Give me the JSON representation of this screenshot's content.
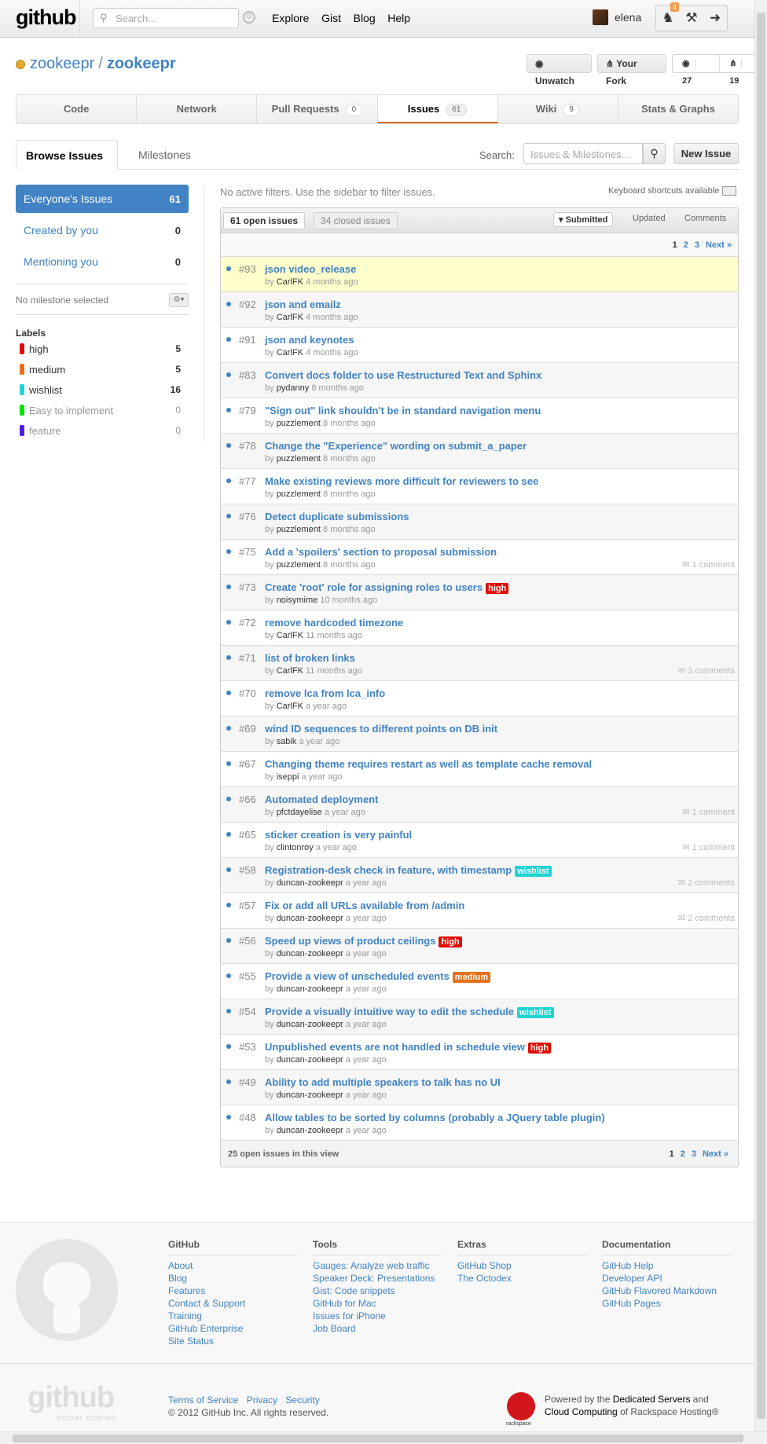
{
  "header": {
    "logo": "github",
    "search_placeholder": "Search...",
    "nav": [
      "Explore",
      "Gist",
      "Blog",
      "Help"
    ],
    "username": "elena",
    "notification_count": "4"
  },
  "repo": {
    "owner": "zookeepr",
    "name": "zookeepr",
    "unwatch_label": "Unwatch",
    "fork_label": "Your Fork",
    "watchers": "27",
    "forks": "19"
  },
  "tabs": [
    {
      "label": "Code",
      "count": ""
    },
    {
      "label": "Network",
      "count": ""
    },
    {
      "label": "Pull Requests",
      "count": "0"
    },
    {
      "label": "Issues",
      "count": "61"
    },
    {
      "label": "Wiki",
      "count": "9"
    },
    {
      "label": "Stats & Graphs",
      "count": ""
    }
  ],
  "subnav": {
    "browse": "Browse Issues",
    "milestones": "Milestones",
    "search_label": "Search:",
    "search_placeholder": "Issues & Milestones...",
    "new_issue": "New Issue"
  },
  "sidebar": {
    "filters": [
      {
        "label": "Everyone's Issues",
        "count": "61"
      },
      {
        "label": "Created by you",
        "count": "0"
      },
      {
        "label": "Mentioning you",
        "count": "0"
      }
    ],
    "milestone": "No milestone selected",
    "labels_title": "Labels",
    "labels": [
      {
        "name": "high",
        "count": "5",
        "color": "#e10c02"
      },
      {
        "name": "medium",
        "count": "5",
        "color": "#e6701a"
      },
      {
        "name": "wishlist",
        "count": "16",
        "color": "#20d3d3"
      },
      {
        "name": "Easy to implement",
        "count": "0",
        "color": "#02e10c"
      },
      {
        "name": "feature",
        "count": "0",
        "color": "#5319e7"
      }
    ]
  },
  "main": {
    "filter_msg": "No active filters. Use the sidebar to filter issues.",
    "keyboard": "Keyboard shortcuts available",
    "open_tab": "61 open issues",
    "closed_tab": "34 closed issues",
    "sorts": [
      "Submitted",
      "Updated",
      "Comments"
    ],
    "pages": [
      "1",
      "2",
      "3",
      "Next »"
    ],
    "footer_count": "25 open issues in this view"
  },
  "issues": [
    {
      "num": "#93",
      "title": "json video_release",
      "by": "CarlFK",
      "when": "4 months ago",
      "label": "",
      "comments": ""
    },
    {
      "num": "#92",
      "title": "json and emailz",
      "by": "CarlFK",
      "when": "4 months ago",
      "label": "",
      "comments": ""
    },
    {
      "num": "#91",
      "title": "json and keynotes",
      "by": "CarlFK",
      "when": "4 months ago",
      "label": "",
      "comments": ""
    },
    {
      "num": "#83",
      "title": "Convert docs folder to use Restructured Text and Sphinx",
      "by": "pydanny",
      "when": "8 months ago",
      "label": "",
      "comments": ""
    },
    {
      "num": "#79",
      "title": "\"Sign out\" link shouldn't be in standard navigation menu",
      "by": "puzzlement",
      "when": "8 months ago",
      "label": "",
      "comments": ""
    },
    {
      "num": "#78",
      "title": "Change the \"Experience\" wording on submit_a_paper",
      "by": "puzzlement",
      "when": "8 months ago",
      "label": "",
      "comments": ""
    },
    {
      "num": "#77",
      "title": "Make existing reviews more difficult for reviewers to see",
      "by": "puzzlement",
      "when": "8 months ago",
      "label": "",
      "comments": ""
    },
    {
      "num": "#76",
      "title": "Detect duplicate submissions",
      "by": "puzzlement",
      "when": "8 months ago",
      "label": "",
      "comments": ""
    },
    {
      "num": "#75",
      "title": "Add a 'spoilers' section to proposal submission",
      "by": "puzzlement",
      "when": "8 months ago",
      "label": "",
      "comments": "1 comment"
    },
    {
      "num": "#73",
      "title": "Create 'root' role for assigning roles to users",
      "by": "noisymime",
      "when": "10 months ago",
      "label": "high",
      "comments": ""
    },
    {
      "num": "#72",
      "title": "remove hardcoded timezone",
      "by": "CarlFK",
      "when": "11 months ago",
      "label": "",
      "comments": ""
    },
    {
      "num": "#71",
      "title": "list of broken links",
      "by": "CarlFK",
      "when": "11 months ago",
      "label": "",
      "comments": "3 comments"
    },
    {
      "num": "#70",
      "title": "remove lca from lca_info",
      "by": "CarlFK",
      "when": "a year ago",
      "label": "",
      "comments": ""
    },
    {
      "num": "#69",
      "title": "wind ID sequences to different points on DB init",
      "by": "sabik",
      "when": "a year ago",
      "label": "",
      "comments": ""
    },
    {
      "num": "#67",
      "title": "Changing theme requires restart as well as template cache removal",
      "by": "iseppi",
      "when": "a year ago",
      "label": "",
      "comments": ""
    },
    {
      "num": "#66",
      "title": "Automated deployment",
      "by": "pfctdayelise",
      "when": "a year ago",
      "label": "",
      "comments": "1 comment"
    },
    {
      "num": "#65",
      "title": "sticker creation is very painful",
      "by": "clintonroy",
      "when": "a year ago",
      "label": "",
      "comments": "1 comment"
    },
    {
      "num": "#58",
      "title": "Registration-desk check in feature, with timestamp",
      "by": "duncan-zookeepr",
      "when": "a year ago",
      "label": "wishlist",
      "comments": "2 comments"
    },
    {
      "num": "#57",
      "title": "Fix or add all URLs available from /admin",
      "by": "duncan-zookeepr",
      "when": "a year ago",
      "label": "",
      "comments": "2 comments"
    },
    {
      "num": "#56",
      "title": "Speed up views of product ceilings",
      "by": "duncan-zookeepr",
      "when": "a year ago",
      "label": "high",
      "comments": ""
    },
    {
      "num": "#55",
      "title": "Provide a view of unscheduled events",
      "by": "duncan-zookeepr",
      "when": "a year ago",
      "label": "medium",
      "comments": ""
    },
    {
      "num": "#54",
      "title": "Provide a visually intuitive way to edit the schedule",
      "by": "duncan-zookeepr",
      "when": "a year ago",
      "label": "wishlist",
      "comments": ""
    },
    {
      "num": "#53",
      "title": "Unpublished events are not handled in schedule view",
      "by": "duncan-zookeepr",
      "when": "a year ago",
      "label": "high",
      "comments": ""
    },
    {
      "num": "#49",
      "title": "Ability to add multiple speakers to talk has no UI",
      "by": "duncan-zookeepr",
      "when": "a year ago",
      "label": "",
      "comments": ""
    },
    {
      "num": "#48",
      "title": "Allow tables to be sorted by columns (probably a JQuery table plugin)",
      "by": "duncan-zookeepr",
      "when": "a year ago",
      "label": "",
      "comments": ""
    }
  ],
  "footer": {
    "columns": [
      {
        "title": "GitHub",
        "links": [
          "About",
          "Blog",
          "Features",
          "Contact & Support",
          "Training",
          "GitHub Enterprise",
          "Site Status"
        ]
      },
      {
        "title": "Tools",
        "links": [
          "Gauges: Analyze web traffic",
          "Speaker Deck: Presentations",
          "Gist: Code snippets",
          "GitHub for Mac",
          "Issues for iPhone",
          "Job Board"
        ]
      },
      {
        "title": "Extras",
        "links": [
          "GitHub Shop",
          "The Octodex"
        ]
      },
      {
        "title": "Documentation",
        "links": [
          "GitHub Help",
          "Developer API",
          "GitHub Flavored Markdown",
          "GitHub Pages"
        ]
      }
    ],
    "logo": "github",
    "logo_sub": "SOCIAL CODING",
    "legal": [
      "Terms of Service",
      "Privacy",
      "Security"
    ],
    "copyright": "© 2012 GitHub Inc. All rights reserved.",
    "rackspace": "rackspace",
    "powered_1": "Powered by the",
    "powered_link1": "Dedicated Servers",
    "powered_2": "and",
    "powered_link2": "Cloud Computing",
    "powered_3": "of Rackspace Hosting®"
  },
  "colors": {
    "accent": "#4183c4",
    "highlight": "#ffffcc",
    "active_tab": "#d26911"
  }
}
